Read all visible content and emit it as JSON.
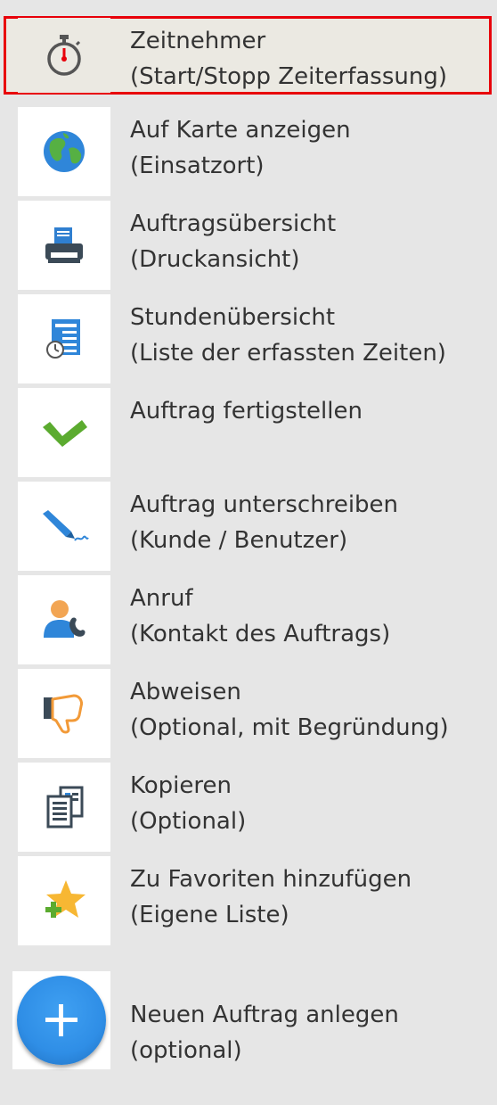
{
  "items": [
    {
      "title": "Zeitnehmer",
      "subtitle": "(Start/Stopp Zeiterfassung)",
      "icon": "stopwatch-icon"
    },
    {
      "title": "Auf Karte anzeigen",
      "subtitle": "(Einsatzort)",
      "icon": "globe-icon"
    },
    {
      "title": "Auftragsübersicht",
      "subtitle": "(Druckansicht)",
      "icon": "printer-icon"
    },
    {
      "title": "Stundenübersicht",
      "subtitle": "(Liste der erfassten Zeiten)",
      "icon": "timesheet-icon"
    },
    {
      "title": "Auftrag fertigstellen",
      "subtitle": "",
      "icon": "checkmark-icon"
    },
    {
      "title": "Auftrag unterschreiben",
      "subtitle": "(Kunde / Benutzer)",
      "icon": "signature-pen-icon"
    },
    {
      "title": "Anruf",
      "subtitle": "(Kontakt des Auftrags)",
      "icon": "contact-phone-icon"
    },
    {
      "title": "Abweisen",
      "subtitle": "(Optional, mit Begründung)",
      "icon": "thumbs-down-icon"
    },
    {
      "title": "Kopieren",
      "subtitle": "(Optional)",
      "icon": "copy-icon"
    },
    {
      "title": "Zu Favoriten hinzufügen",
      "subtitle": "(Eigene Liste)",
      "icon": "add-favorite-icon"
    }
  ],
  "new_order": {
    "title": "Neuen Auftrag anlegen",
    "subtitle": "(optional)",
    "icon": "plus-icon"
  },
  "colors": {
    "background": "#e6e6e6",
    "tile": "#ffffff",
    "highlight_border": "#e8000a",
    "text": "#333333",
    "fab_blue": "#2f8ee6",
    "check_green": "#5bab2f"
  }
}
